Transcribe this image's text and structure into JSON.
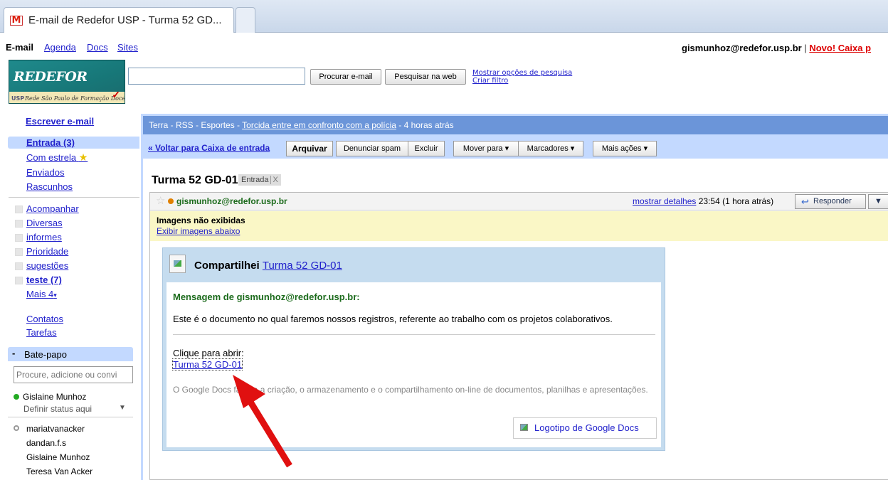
{
  "tab": {
    "title": "E-mail de Redefor USP - Turma 52 GD..."
  },
  "topnav": {
    "current": "E-mail",
    "links": [
      "Agenda",
      "Docs",
      "Sites"
    ],
    "user_email": "gismunhoz@redefor.usp.br",
    "separator": "|",
    "novo": "Novo! Caixa p"
  },
  "logo": {
    "title": "REDEFOR",
    "subtitle": "Rede São Paulo de Formação Docente",
    "prefix": "USP"
  },
  "search": {
    "value": "",
    "btn_mail": "Procurar e-mail",
    "btn_web": "Pesquisar na web",
    "options_link": "Mostrar opções de pesquisa",
    "filter_link": "Criar filtro"
  },
  "leftnav": {
    "compose": "Escrever e-mail",
    "inbox": "Entrada (3)",
    "starred": "Com estrela",
    "sent": "Enviados",
    "drafts": "Rascunhos",
    "labels": [
      "Acompanhar",
      "Diversas",
      "informes",
      "Prioridade",
      "sugestões",
      "teste (7)"
    ],
    "more": "Mais 4",
    "contacts": "Contatos",
    "tasks": "Tarefas"
  },
  "chat": {
    "title": "Bate-papo",
    "minus": "-",
    "search_placeholder": "Procure, adicione ou convi",
    "me": "Gislaine Munhoz",
    "status": "Definir status aqui",
    "contacts": [
      "mariatvanacker",
      "dandan.f.s",
      "Gislaine Munhoz",
      "Teresa Van Acker"
    ]
  },
  "rss": {
    "prefix": "Terra - RSS - Esportes - ",
    "link": "Torcida entre em confronto com a polícia",
    "suffix": " - 4 horas atrás"
  },
  "toolbar": {
    "back": "« Voltar para Caixa de entrada",
    "archive": "Arquivar",
    "spam": "Denunciar spam",
    "delete": "Excluir",
    "move": "Mover para ▾",
    "labels": "Marcadores ▾",
    "more": "Mais ações ▾"
  },
  "message": {
    "subject": "Turma 52 GD-01",
    "label": "Entrada",
    "label_x": "X",
    "sender": "gismunhoz@redefor.usp.br",
    "show_details": "mostrar detalhes",
    "time": "23:54 (1 hora atrás)",
    "reply": "Responder",
    "reply_more": "▼",
    "images_notice": "Imagens não exibidas",
    "show_images": "Exibir imagens abaixo"
  },
  "share": {
    "title_prefix": "Compartilhei",
    "doc_name": "Turma 52 GD-01",
    "from_line": "Mensagem de gismunhoz@redefor.usp.br:",
    "text": "Este é o documento no qual faremos nossos registros, referente ao trabalho com os projetos colaborativos.",
    "click_to_open": "Clique para abrir:",
    "doc_link": "Turma 52 GD-01",
    "description": "O Google Docs facilita a criação, o armazenamento e o compartilhamento on-line de documentos, planilhas e apresentações.",
    "logo_button": "Logotipo de Google Docs"
  },
  "colors": {
    "accent": "#c3d9ff",
    "rss_bar": "#6b95d9",
    "link": "#2222cc",
    "sender": "#1c6b1c",
    "arrow": "#e01010"
  }
}
